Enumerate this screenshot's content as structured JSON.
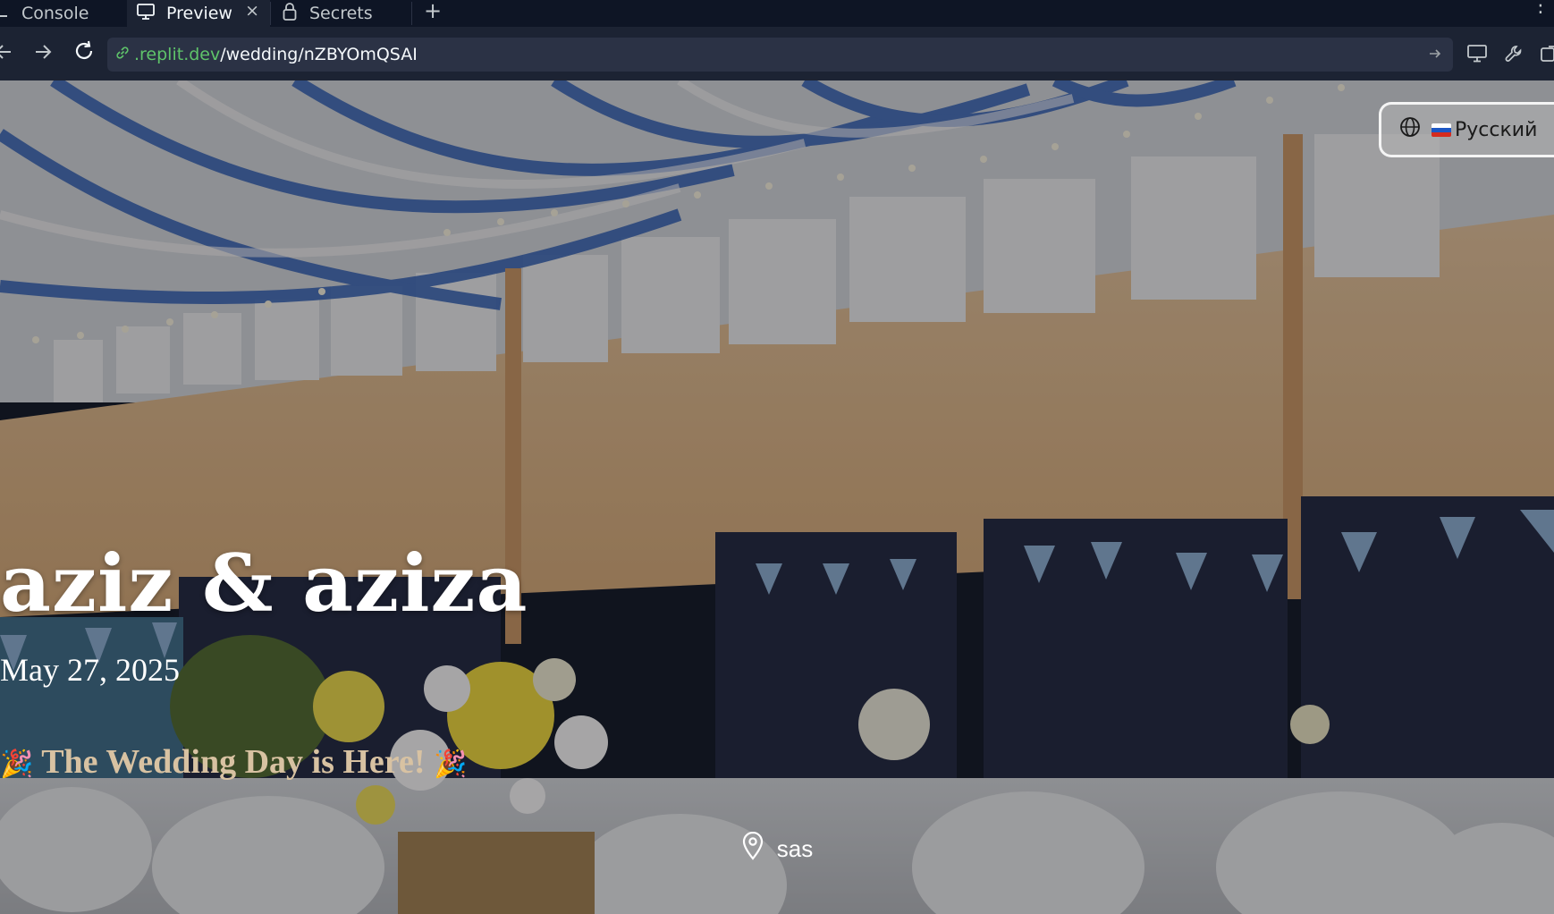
{
  "tabs": {
    "console": "Console",
    "preview": "Preview",
    "secrets": "Secrets"
  },
  "address_bar": {
    "host": ".replit.dev",
    "path": "/wedding/nZBYOmQSAI"
  },
  "page": {
    "language_label": "Русский",
    "couple": "aziz & aziza",
    "date": "May 27, 2025",
    "tagline": "The Wedding Day is Here!",
    "tagline_emoji": "🎉",
    "venue": "sas"
  },
  "colors": {
    "ide_background": "#0e1525",
    "ide_surface": "#1c2333",
    "url_host": "#5fc46a",
    "tagline": "#d8c2a2"
  },
  "icons": {
    "preview_tab": "monitor-icon",
    "secrets_tab": "lock-icon",
    "language": "globe-icon",
    "venue": "map-pin-icon"
  }
}
